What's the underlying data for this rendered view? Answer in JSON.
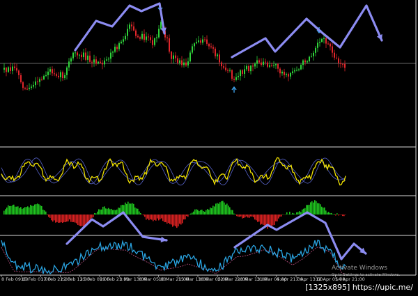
{
  "colors": {
    "background": "#000000",
    "separator": "#d8d8d8",
    "bull_candle": "#2fd33a",
    "bear_candle": "#e0262b",
    "level_line": "#8a8a8a",
    "osc_main": "#f2e300",
    "osc_band": "#5662c9",
    "hist_up": "#1fc51f",
    "hist_down": "#d82121",
    "line_main": "#2aa4e2",
    "line_signal": "#b04a78",
    "wave_arrow": "#8c8cf2",
    "marker_arrow": "#3fa0e8"
  },
  "icons": {
    "wave_arrow": "arrow-icon",
    "marker": "down-arrow-icon"
  },
  "x_axis": {
    "labels": [
      "8 Feb 09:00",
      "15 Feb 01:00",
      "17 Feb 21:00",
      "22 Feb 13:00",
      "25 Feb 05:00",
      "29 Feb 21:00",
      "3 Mar 13:00",
      "8 Mar 05:00",
      "10 Mar 21:00",
      "15 Mar 13:00",
      "18 Mar 05:00",
      "22 Mar 21:00",
      "28 Mar 13:00",
      "31 Mar 05:00",
      "4 Apr 21:00",
      "7 Apr 13:00",
      "12 Apr 05:00",
      "14 Apr 21:00"
    ]
  },
  "watermark": {
    "line1": "Activate Windows",
    "line2": "Go to Settings to activate Windows."
  },
  "badge": "[1325x895] https://upic.me/"
}
